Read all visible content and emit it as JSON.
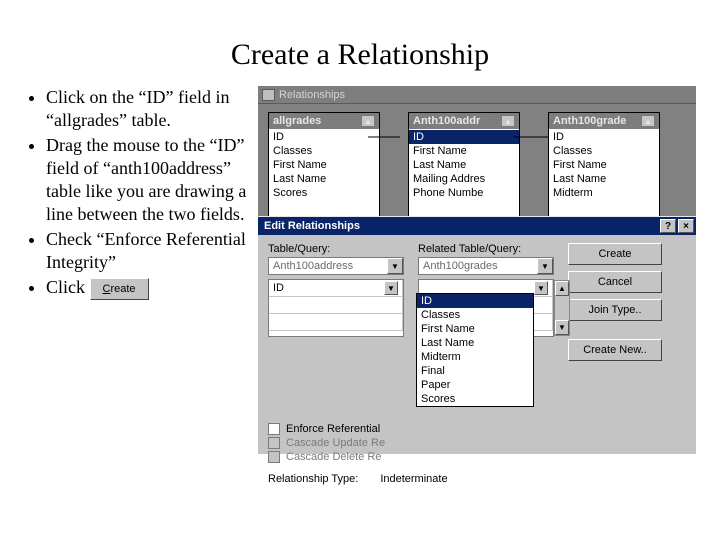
{
  "title": "Create a Relationship",
  "bullets": [
    "Click on the “ID” field in “allgrades” table.",
    "Drag the mouse to the “ID” field of “anth100address” table like you are drawing a line between the two fields.",
    "Check “Enforce Referential Integrity”",
    "Click"
  ],
  "inline_create_btn": "Create",
  "rel_window": {
    "title": "Relationships",
    "tables": [
      {
        "name": "allgrades",
        "fields": [
          "ID",
          "Classes",
          "First Name",
          "Last Name",
          "Scores"
        ],
        "selected": null
      },
      {
        "name": "Anth100addr",
        "fields": [
          "ID",
          "First Name",
          "Last Name",
          "Mailing Addres",
          "Phone Numbe"
        ],
        "selected": 0
      },
      {
        "name": "Anth100grade",
        "fields": [
          "ID",
          "Classes",
          "First Name",
          "Last Name",
          "Midterm"
        ],
        "selected": null
      }
    ]
  },
  "dialog": {
    "title": "Edit Relationships",
    "left_label": "Table/Query:",
    "right_label": "Related Table/Query:",
    "left_combo": "Anth100address",
    "right_combo": "Anth100grades",
    "left_field": "ID",
    "dropdown_items": [
      "ID",
      "Classes",
      "First Name",
      "Last Name",
      "Midterm",
      "Final",
      "Paper",
      "Scores"
    ],
    "dropdown_selected": 0,
    "check_enforce": "Enforce Referential",
    "check_cascade_update": "Cascade Update Re",
    "check_cascade_delete": "Cascade Delete Re",
    "rel_type_label": "Relationship Type:",
    "rel_type_value": "Indeterminate",
    "buttons": {
      "create": "Create",
      "cancel": "Cancel",
      "join": "Join Type..",
      "new": "Create New.."
    }
  }
}
